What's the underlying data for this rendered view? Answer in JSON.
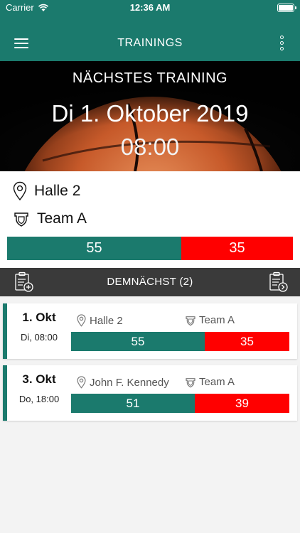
{
  "status_bar": {
    "carrier": "Carrier",
    "time": "12:36 AM"
  },
  "navbar": {
    "title": "TRAININGS"
  },
  "next_training": {
    "label": "NÄCHSTES TRAINING",
    "date": "Di 1. Oktober 2019",
    "time": "08:00",
    "location": "Halle 2",
    "team": "Team A",
    "yes_count": "55",
    "no_count": "35"
  },
  "upcoming": {
    "title": "DEMNÄCHST (2)",
    "items": [
      {
        "day": "1. Okt",
        "weekday_time": "Di, 08:00",
        "location": "Halle 2",
        "team": "Team A",
        "yes": "55",
        "no": "35"
      },
      {
        "day": "3. Okt",
        "weekday_time": "Do, 18:00",
        "location": "John F. Kennedy",
        "team": "Team A",
        "yes": "51",
        "no": "39"
      }
    ]
  },
  "colors": {
    "teal": "#1b7a6d",
    "red": "#ff0000",
    "dark": "#3a3a3a"
  },
  "icons": {
    "menu": "hamburger-icon",
    "more": "more-vertical-icon",
    "location": "map-pin-icon",
    "team": "shield-icon",
    "add": "clipboard-add-icon",
    "next": "clipboard-arrow-icon"
  }
}
